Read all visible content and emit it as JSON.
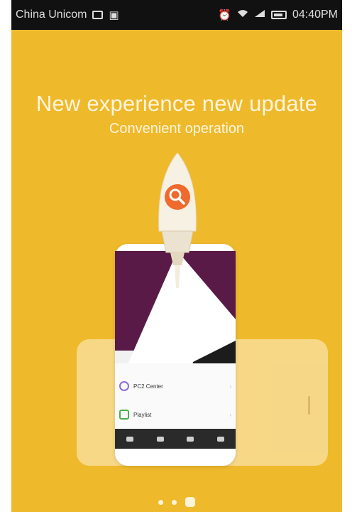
{
  "status_bar": {
    "carrier": "China Unicom",
    "time": "04:40PM",
    "icons": [
      "image-notification-icon",
      "message-notification-icon",
      "alarm-icon",
      "wifi-icon",
      "signal-icon",
      "battery-icon"
    ]
  },
  "onboarding": {
    "headline": "New experience new update",
    "subheadline": "Convenient operation",
    "search_badge_icon": "search-icon"
  },
  "phone_preview": {
    "list_items": [
      {
        "title": "PC2 Center",
        "subtitle": "",
        "icon": "purple-circle-icon"
      },
      {
        "title": "Playlist",
        "subtitle": "",
        "icon": "green-square-icon"
      }
    ],
    "nav_items": [
      "",
      "",
      "",
      ""
    ]
  },
  "pager": {
    "pages": 3,
    "active_index": 2
  },
  "colors": {
    "background": "#efb92c",
    "text_light": "#fff5dc",
    "search_badge": "#ef6a2c",
    "purple_panel": "#5a1a47"
  }
}
